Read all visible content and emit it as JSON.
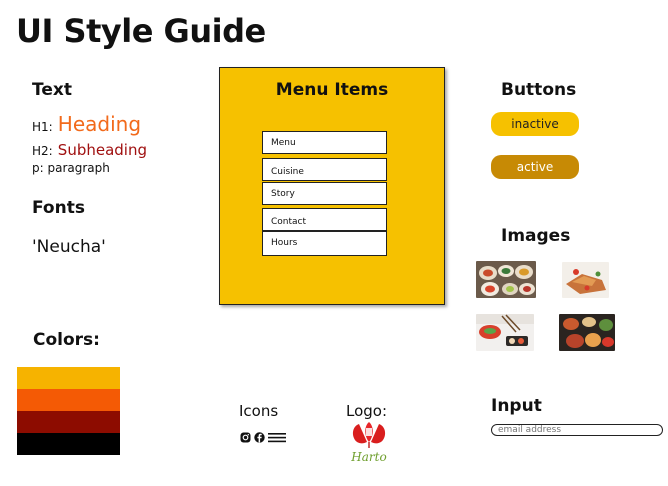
{
  "page": {
    "title": "UI Style Guide"
  },
  "text_section": {
    "heading": "Text",
    "h1_prefix": "H1:",
    "h1_value": "Heading",
    "h2_prefix": "H2:",
    "h2_value": "Subheading",
    "p_line": "p: paragraph"
  },
  "fonts_section": {
    "heading": "Fonts",
    "font_name": "'Neucha'"
  },
  "menu": {
    "heading": "Menu Items",
    "items": [
      "Menu",
      "Cuisine",
      "Story",
      "Contact",
      "Hours"
    ]
  },
  "buttons": {
    "heading": "Buttons",
    "inactive_label": "inactive",
    "active_label": "active",
    "inactive_color": "#f6c100",
    "active_color": "#c78a05"
  },
  "images": {
    "heading": "Images"
  },
  "colors": {
    "heading": "Colors:",
    "swatches": [
      "#f6b300",
      "#f45a05",
      "#8d0c00",
      "#000000"
    ]
  },
  "icons": {
    "heading": "Icons",
    "list": [
      "instagram-icon",
      "facebook-icon",
      "hamburger-menu-icon"
    ]
  },
  "logo": {
    "heading": "Logo:",
    "wordmark": "Harto"
  },
  "input": {
    "heading": "Input",
    "placeholder": "email address"
  }
}
